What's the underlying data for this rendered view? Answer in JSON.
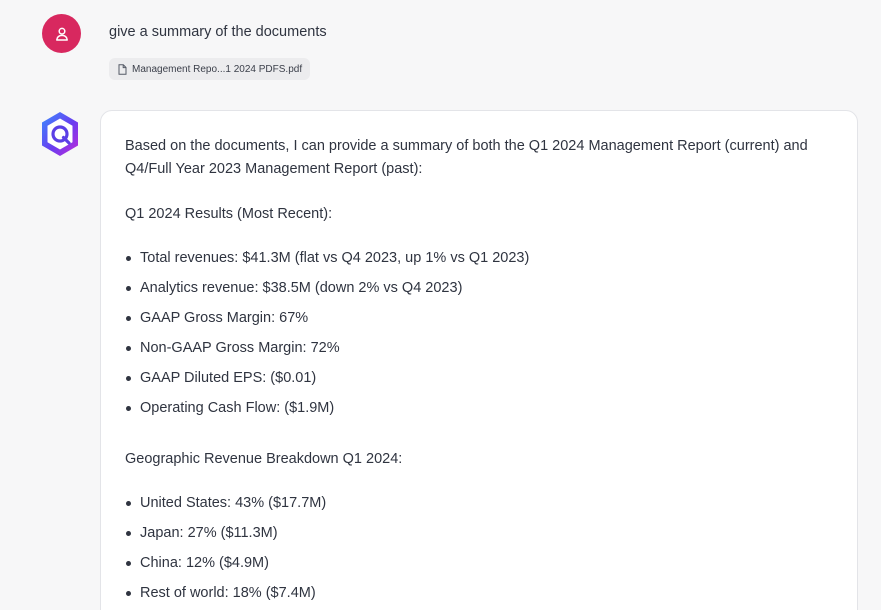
{
  "user_message": {
    "text": "give a summary of the documents",
    "attachment_name": "Management Repo...1 2024 PDFS.pdf",
    "avatar_icon": "user-icon",
    "avatar_color": "#d8285f"
  },
  "assistant_message": {
    "avatar_icon": "assistant-logo-icon",
    "intro": "Based on the documents, I can provide a summary of both the Q1 2024 Management Report (current) and Q4/Full Year 2023 Management Report (past):",
    "sections": [
      {
        "title": "Q1 2024 Results (Most Recent):",
        "items": [
          "Total revenues: $41.3M (flat vs Q4 2023, up 1% vs Q1 2023)",
          "Analytics revenue: $38.5M (down 2% vs Q4 2023)",
          "GAAP Gross Margin: 67%",
          "Non-GAAP Gross Margin: 72%",
          "GAAP Diluted EPS: ($0.01)",
          "Operating Cash Flow: ($1.9M)"
        ]
      },
      {
        "title": "Geographic Revenue Breakdown Q1 2024:",
        "items": [
          "United States: 43% ($17.7M)",
          "Japan: 27% ($11.3M)",
          "China: 12% ($4.9M)",
          "Rest of world: 18% ($7.4M)"
        ]
      }
    ]
  }
}
